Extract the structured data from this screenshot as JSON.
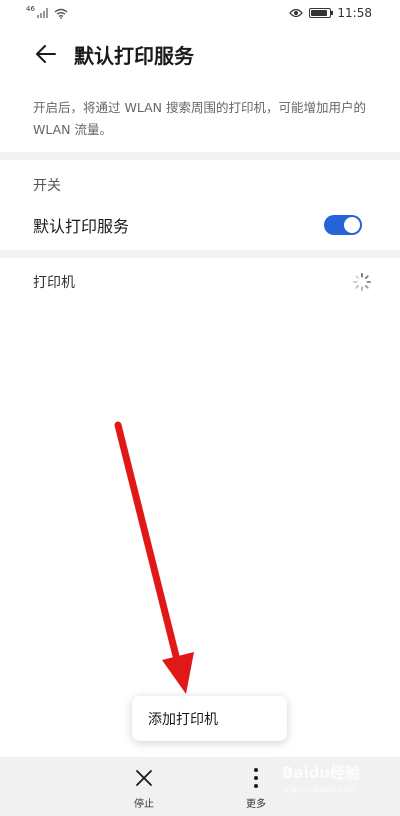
{
  "status_bar": {
    "signal_label": "46",
    "time": "11:58",
    "icons": [
      "signal-icon",
      "wifi-icon",
      "eye-icon",
      "battery-icon"
    ]
  },
  "header": {
    "title": "默认打印服务",
    "back_icon": "back-arrow-icon"
  },
  "description": "开启后，将通过 WLAN 搜索周围的打印机，可能增加用户的 WLAN 流量。",
  "switch_section": {
    "title": "开关",
    "item_label": "默认打印服务",
    "enabled": true
  },
  "printers_section": {
    "title": "打印机",
    "loading_icon": "loading-spinner-icon"
  },
  "popup_menu": {
    "item_label": "添加打印机"
  },
  "bottom_bar": {
    "stop_label": "停止",
    "more_label": "更多",
    "stop_icon": "close-icon",
    "more_icon": "more-vertical-icon"
  },
  "annotation": {
    "arrow_color": "#e01818"
  },
  "watermark": {
    "logo_text": "Baidu经验",
    "url_text": "jingyan.baidu.com"
  },
  "colors": {
    "accent": "#2563d9",
    "divider": "#f3f3f3",
    "bottom_bar": "#f1f1f1"
  }
}
